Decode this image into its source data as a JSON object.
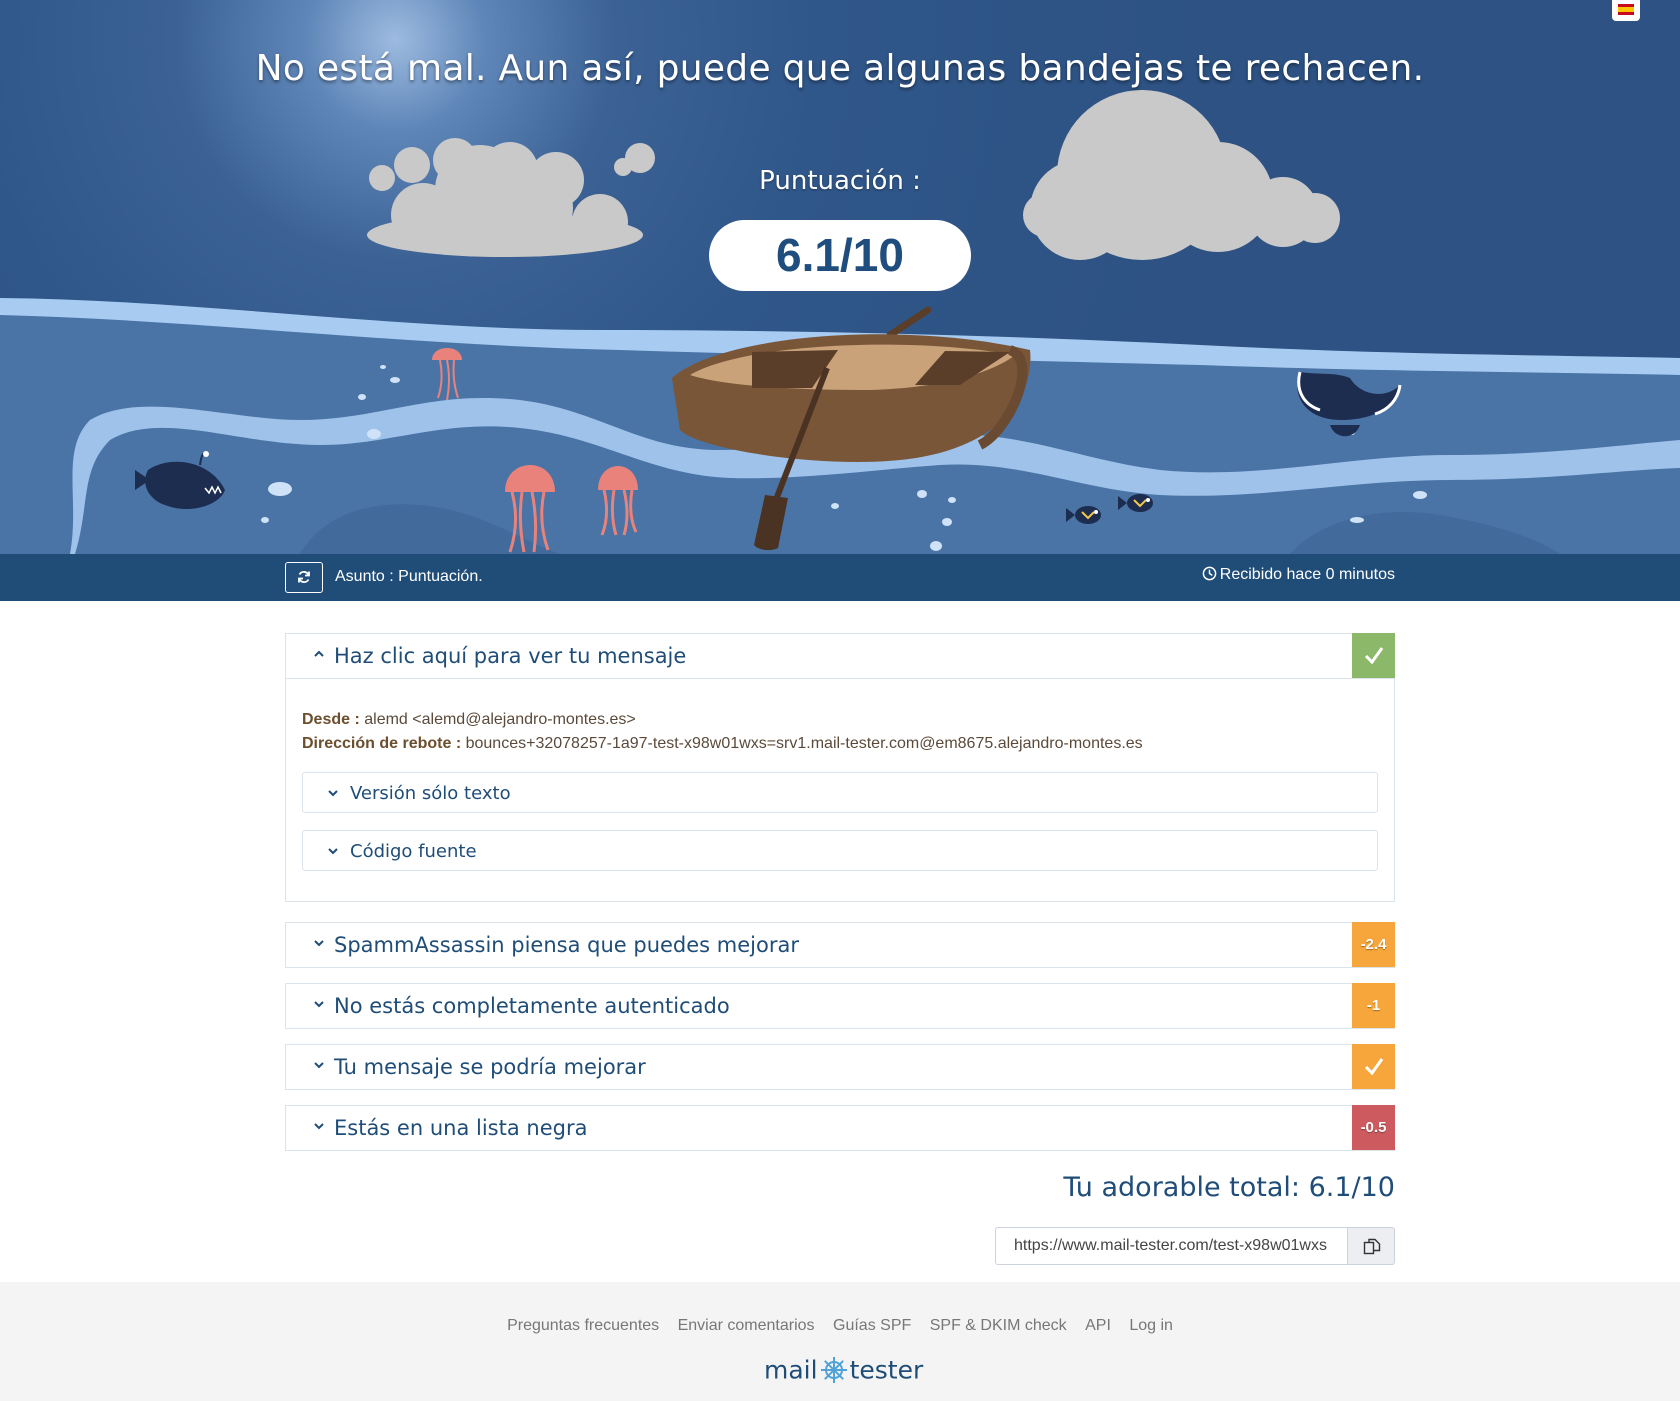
{
  "hero": {
    "headline": "No está mal. Aun así, puede que algunas bandejas te rechacen.",
    "score_label": "Puntuación :",
    "score_value": "6.1/10",
    "language_flag_icon": "spain-flag-icon"
  },
  "subject_bar": {
    "subject": "Asunto : Puntuación.",
    "received": "Recibido hace 0 minutos",
    "refresh_icon": "refresh-icon",
    "clock_icon": "clock-icon"
  },
  "message_panel": {
    "title": "Haz clic aquí para ver tu mensaje",
    "from_label": "Desde :",
    "from_value": "alemd <alemd@alejandro-montes.es>",
    "bounce_label": "Dirección de rebote :",
    "bounce_value": "bounces+32078257-1a97-test-x98w01wxs=srv1.mail-tester.com@em8675.alejandro-montes.es",
    "subpanels": [
      "Versión sólo texto",
      "Código fuente"
    ],
    "badge": "check",
    "badge_color": "#8cb86a"
  },
  "result_panels": [
    {
      "title": "SpammAssassin piensa que puedes mejorar",
      "badge": "-2.4",
      "badge_color": "#f6a63a"
    },
    {
      "title": "No estás completamente autenticado",
      "badge": "-1",
      "badge_color": "#f6a63a"
    },
    {
      "title": "Tu mensaje se podría mejorar",
      "badge": "check",
      "badge_color": "#f6a63a"
    },
    {
      "title": "Estás en una lista negra",
      "badge": "-0.5",
      "badge_color": "#cd5a5e"
    }
  ],
  "total": "Tu adorable total: 6.1/10",
  "share": {
    "url": "https://www.mail-tester.com/test-x98w01wxs",
    "copy_icon": "copy-icon"
  },
  "footer": {
    "links": [
      "Preguntas frecuentes",
      "Enviar comentarios",
      "Guías SPF",
      "SPF & DKIM check",
      "API",
      "Log in"
    ],
    "logo_left": "mail",
    "logo_right": "tester"
  }
}
